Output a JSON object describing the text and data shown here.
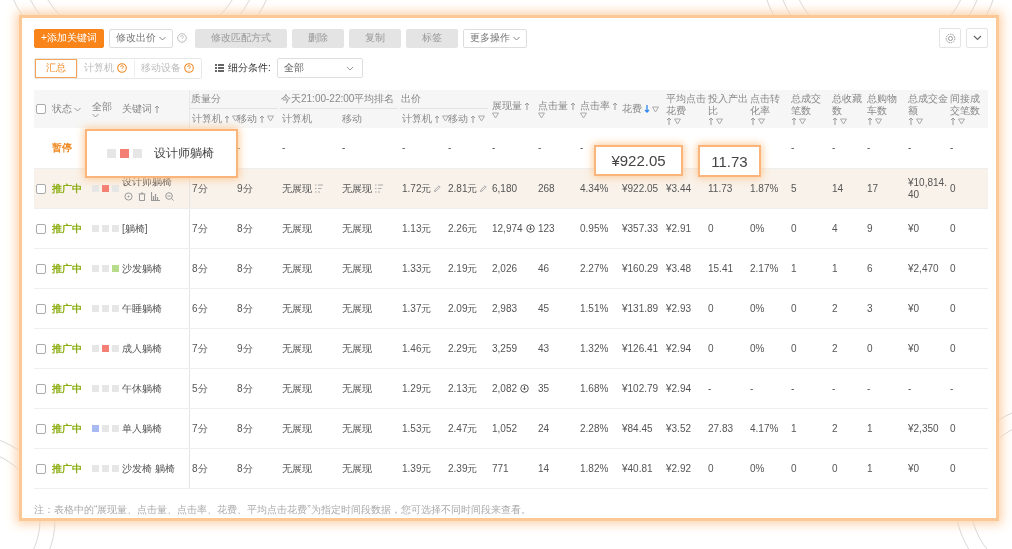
{
  "toolbar": {
    "items": [
      {
        "label": "+添加关键词",
        "kind": "primary"
      },
      {
        "label": "修改出价",
        "kind": "dropdown"
      },
      {
        "kind": "help"
      },
      {
        "label": "修改匹配方式",
        "kind": "disabled"
      },
      {
        "label": "删除",
        "kind": "disabled"
      },
      {
        "label": "复制",
        "kind": "disabled"
      },
      {
        "label": "标签",
        "kind": "disabled"
      },
      {
        "label": "更多操作",
        "kind": "dropdown"
      }
    ]
  },
  "view_tabs": [
    {
      "label": "汇总",
      "selected": true,
      "help": false
    },
    {
      "label": "计算机",
      "selected": false,
      "help": true
    },
    {
      "label": "移动设备",
      "selected": false,
      "help": true
    }
  ],
  "segment_filter": {
    "label": "细分条件:",
    "value": "全部"
  },
  "table": {
    "select_all": {
      "checked": false
    },
    "header_left": [
      {
        "label": "状态",
        "kind": "dropdown"
      },
      {
        "label": "全部",
        "kind": "dropdown"
      },
      {
        "label": "关键词",
        "kind": "sort"
      }
    ],
    "columns": [
      {
        "kind": "group_start",
        "group": "质量分",
        "label": "计算机",
        "sortable": true,
        "sorted": false,
        "filterable": true
      },
      {
        "kind": "group_member",
        "label": "移动",
        "sortable": true,
        "sorted": false,
        "filterable": true
      },
      {
        "kind": "group_start",
        "group": "今天21:00-22:00平均排名",
        "label": "计算机",
        "sortable": false,
        "filterable": false
      },
      {
        "kind": "group_member",
        "label": "移动",
        "sortable": false,
        "filterable": false
      },
      {
        "kind": "group_start",
        "group": "出价",
        "label": "计算机",
        "sortable": true,
        "sorted": false,
        "filterable": true
      },
      {
        "kind": "group_member",
        "label": "移动",
        "sortable": true,
        "sorted": false,
        "filterable": true
      },
      {
        "kind": "single",
        "label": "展现量",
        "sortable": true,
        "sorted": false,
        "filterable": true
      },
      {
        "kind": "single",
        "label": "点击量",
        "sortable": true,
        "sorted": false,
        "filterable": true
      },
      {
        "kind": "single",
        "label": "点击率",
        "sortable": true,
        "sorted": false,
        "filterable": true
      },
      {
        "kind": "single",
        "label": "花费",
        "sortable": true,
        "sorted": true,
        "filterable": true
      },
      {
        "kind": "single",
        "label": "平均点击花费",
        "sortable": true,
        "sorted": false,
        "filterable": true
      },
      {
        "kind": "single",
        "label": "投入产出比",
        "sortable": true,
        "sorted": false,
        "filterable": true
      },
      {
        "kind": "single",
        "label": "点击转化率",
        "sortable": true,
        "sorted": false,
        "filterable": true
      },
      {
        "kind": "single",
        "label": "总成交笔数",
        "sortable": true,
        "sorted": false,
        "filterable": true
      },
      {
        "kind": "single",
        "label": "总收藏数",
        "sortable": true,
        "sorted": false,
        "filterable": true
      },
      {
        "kind": "single",
        "label": "总购物车数",
        "sortable": true,
        "sorted": false,
        "filterable": true
      },
      {
        "kind": "single",
        "label": "总成交金额",
        "sortable": true,
        "sorted": false,
        "filterable": true
      },
      {
        "kind": "single",
        "label": "间接成交笔数",
        "sortable": true,
        "sorted": false,
        "filterable": true
      }
    ],
    "rows": [
      {
        "status": "暂停",
        "paused": true,
        "selected": false,
        "impression_icon": false,
        "cells": [
          null,
          "-",
          "-",
          "-",
          "-",
          "-",
          "-",
          "-",
          "-",
          null,
          null,
          null,
          null,
          "-",
          "-",
          "-",
          "-",
          "-"
        ]
      },
      {
        "status": "推广中",
        "paused": false,
        "checked": false,
        "selected": true,
        "impression_icon": false,
        "tags": [
          {
            "color": "#e6e6e6"
          },
          {
            "color": "#f47f74"
          },
          {
            "color": "#e6e6e6"
          }
        ],
        "keyword": "设计师躺椅",
        "cells": [
          "7分",
          "9分",
          "无展现",
          "无展现",
          "1.72元",
          "2.81元",
          "6,180",
          "268",
          "4.34%",
          "¥922.05",
          "¥3.44",
          "11.73",
          "1.87%",
          "5",
          "14",
          "17",
          "¥10,814.40",
          "0"
        ]
      },
      {
        "status": "推广中",
        "paused": false,
        "checked": false,
        "selected": false,
        "impression_icon": true,
        "tags": [
          {
            "color": "#e6e6e6"
          },
          {
            "color": "#e6e6e6"
          },
          {
            "color": "#e6e6e6"
          }
        ],
        "keyword": "[躺椅]",
        "cells": [
          "7分",
          "8分",
          "无展现",
          "无展现",
          "1.13元",
          "2.26元",
          "12,974",
          "123",
          "0.95%",
          "¥357.33",
          "¥2.91",
          "0",
          "0%",
          "0",
          "4",
          "9",
          "¥0",
          "0"
        ]
      },
      {
        "status": "推广中",
        "paused": false,
        "checked": false,
        "selected": false,
        "impression_icon": false,
        "tags": [
          {
            "color": "#e6e6e6"
          },
          {
            "color": "#e6e6e6"
          },
          {
            "color": "#b7dc8c"
          }
        ],
        "keyword": "沙发躺椅",
        "cells": [
          "8分",
          "8分",
          "无展现",
          "无展现",
          "1.33元",
          "2.19元",
          "2,026",
          "46",
          "2.27%",
          "¥160.29",
          "¥3.48",
          "15.41",
          "2.17%",
          "1",
          "1",
          "6",
          "¥2,470",
          "0"
        ]
      },
      {
        "status": "推广中",
        "paused": false,
        "checked": false,
        "selected": false,
        "impression_icon": false,
        "tags": [
          {
            "color": "#e6e6e6"
          },
          {
            "color": "#e6e6e6"
          },
          {
            "color": "#e6e6e6"
          }
        ],
        "keyword": "午睡躺椅",
        "cells": [
          "6分",
          "8分",
          "无展现",
          "无展现",
          "1.37元",
          "2.09元",
          "2,983",
          "45",
          "1.51%",
          "¥131.89",
          "¥2.93",
          "0",
          "0%",
          "0",
          "2",
          "3",
          "¥0",
          "0"
        ]
      },
      {
        "status": "推广中",
        "paused": false,
        "checked": false,
        "selected": false,
        "impression_icon": false,
        "tags": [
          {
            "color": "#e6e6e6"
          },
          {
            "color": "#f47f74"
          },
          {
            "color": "#e6e6e6"
          }
        ],
        "keyword": "成人躺椅",
        "cells": [
          "7分",
          "9分",
          "无展现",
          "无展现",
          "1.46元",
          "2.29元",
          "3,259",
          "43",
          "1.32%",
          "¥126.41",
          "¥2.94",
          "0",
          "0%",
          "0",
          "2",
          "0",
          "¥0",
          "0"
        ]
      },
      {
        "status": "推广中",
        "paused": false,
        "checked": false,
        "selected": false,
        "impression_icon": true,
        "tags": [
          {
            "color": "#e6e6e6"
          },
          {
            "color": "#e6e6e6"
          },
          {
            "color": "#e6e6e6"
          }
        ],
        "keyword": "午休躺椅",
        "cells": [
          "5分",
          "8分",
          "无展现",
          "无展现",
          "1.29元",
          "2.13元",
          "2,082",
          "35",
          "1.68%",
          "¥102.79",
          "¥2.94",
          "-",
          "-",
          "-",
          "-",
          "-",
          "-",
          "-"
        ]
      },
      {
        "status": "推广中",
        "paused": false,
        "checked": false,
        "selected": false,
        "impression_icon": false,
        "tags": [
          {
            "color": "#a9b9f2"
          },
          {
            "color": "#e6e6e6"
          },
          {
            "color": "#e6e6e6"
          }
        ],
        "keyword": "单人躺椅",
        "cells": [
          "7分",
          "8分",
          "无展现",
          "无展现",
          "1.53元",
          "2.47元",
          "1,052",
          "24",
          "2.28%",
          "¥84.45",
          "¥3.52",
          "27.83",
          "4.17%",
          "1",
          "2",
          "1",
          "¥2,350",
          "0"
        ]
      },
      {
        "status": "推广中",
        "paused": false,
        "checked": false,
        "selected": false,
        "impression_icon": false,
        "tags": [
          {
            "color": "#e6e6e6"
          },
          {
            "color": "#e6e6e6"
          },
          {
            "color": "#e6e6e6"
          }
        ],
        "keyword": "沙发椅 躺椅",
        "cells": [
          "8分",
          "8分",
          "无展现",
          "无展现",
          "1.39元",
          "2.39元",
          "771",
          "14",
          "1.82%",
          "¥40.81",
          "¥2.92",
          "0",
          "0%",
          "0",
          "0",
          "1",
          "¥0",
          "0"
        ]
      }
    ]
  },
  "note": "注：表格中的“展现量、点击量、点击率、花费、平均点击花费”为指定时间段数据，您可选择不同时间段来查看。",
  "callouts": [
    {
      "kind": "keyword",
      "text": "设计师躺椅",
      "tags": [
        {
          "color": "#e6e6e6"
        },
        {
          "color": "#f47f74"
        },
        {
          "color": "#e6e6e6"
        }
      ]
    },
    {
      "kind": "value",
      "text": "¥922.05"
    },
    {
      "kind": "value",
      "text": "11.73"
    }
  ]
}
